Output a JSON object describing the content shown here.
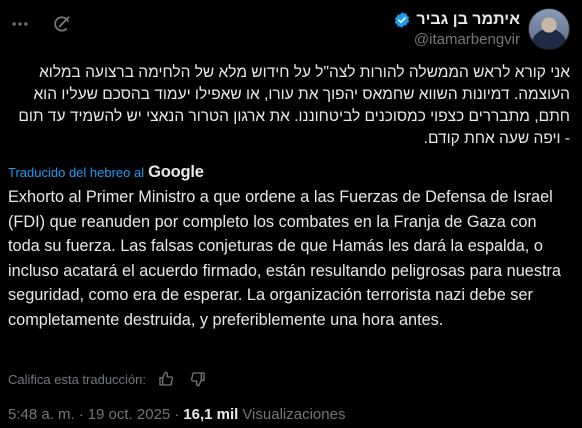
{
  "author": {
    "display_name": "איתמר בן גביר",
    "handle": "@itamarbengvir"
  },
  "tweet": {
    "original_text": "אני קורא לראש הממשלה להורות לצה\"ל על חידוש מלא של הלחימה ברצועה במלוא העוצמה. דמיונות השווא שחמאס יהפוך את עורו, או שאפילו יעמוד בהסכם שעליו הוא חתם, מתבררים כצפוי כמסוכנים לביטחוננו. את ארגון הטרור הנאצי יש להשמיד עד תום - ויפה שעה אחת קודם.",
    "translated_label": "Traducido del hebreo al",
    "translator_brand": "Google",
    "translated_text": "Exhorto al Primer Ministro a que ordene a las Fuerzas de Defensa de Israel (FDI) que reanuden por completo los combates en la Franja de Gaza con toda su fuerza. Las falsas conjeturas de que Hamás les dará la espalda, o incluso acatará el acuerdo firmado, están resultando peligrosas para nuestra seguridad, como era de esperar. La organización terrorista nazi debe ser completamente destruida, y preferiblemente una hora antes.",
    "rate_prompt": "Califica esta traducción:",
    "time": "5:48 a. m.",
    "separator": "·",
    "date": "19 oct. 2025",
    "views_count": "16,1 mil",
    "views_label": "Visualizaciones"
  },
  "icons": {
    "more": "more-horizontal-icon",
    "grok": "grok-icon",
    "verified": "verified-badge-icon",
    "thumbs_up": "thumbs-up-icon",
    "thumbs_down": "thumbs-down-icon"
  },
  "colors": {
    "background": "#000000",
    "text": "#e7e9ea",
    "muted": "#71767b",
    "link": "#1d9bf0",
    "verified": "#1d9bf0"
  }
}
